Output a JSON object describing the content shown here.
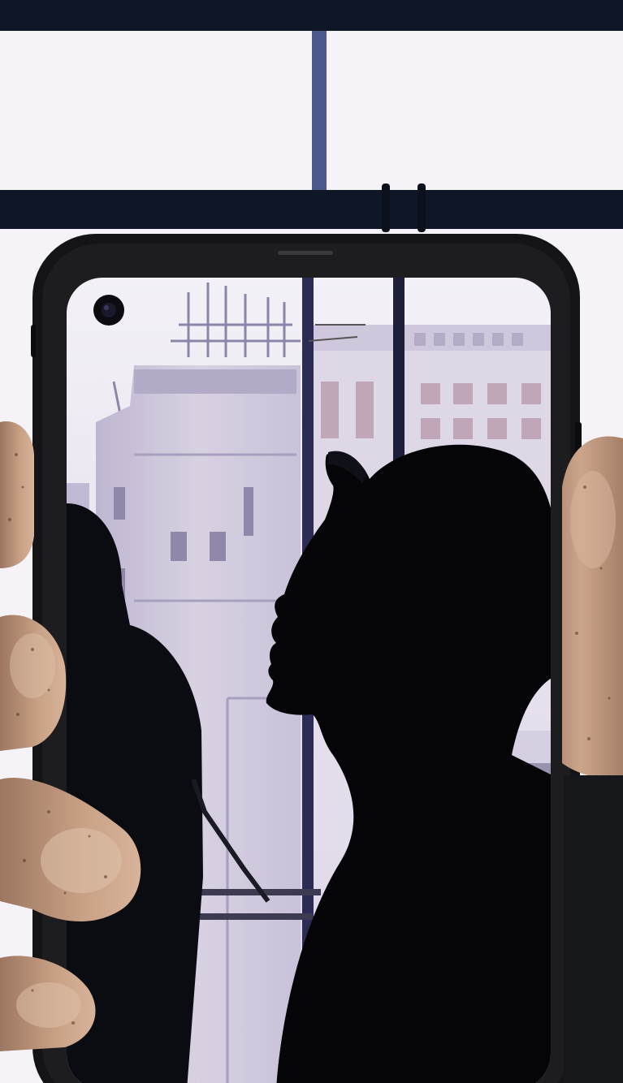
{
  "image": {
    "kind": "photo-composite",
    "subject": "hands-holding-rugged-smartphone",
    "icons": [
      "front-camera-icon"
    ],
    "colors": {
      "window_frame": "#101828",
      "window_glass": "#f5f3f7",
      "phone_bezel": "#141416",
      "screen_sky": "#ebe6f2",
      "building": "#cfc8dc",
      "silhouette": "#050508",
      "skin": "#c9a286",
      "skin_shadow": "#9c7660"
    }
  }
}
